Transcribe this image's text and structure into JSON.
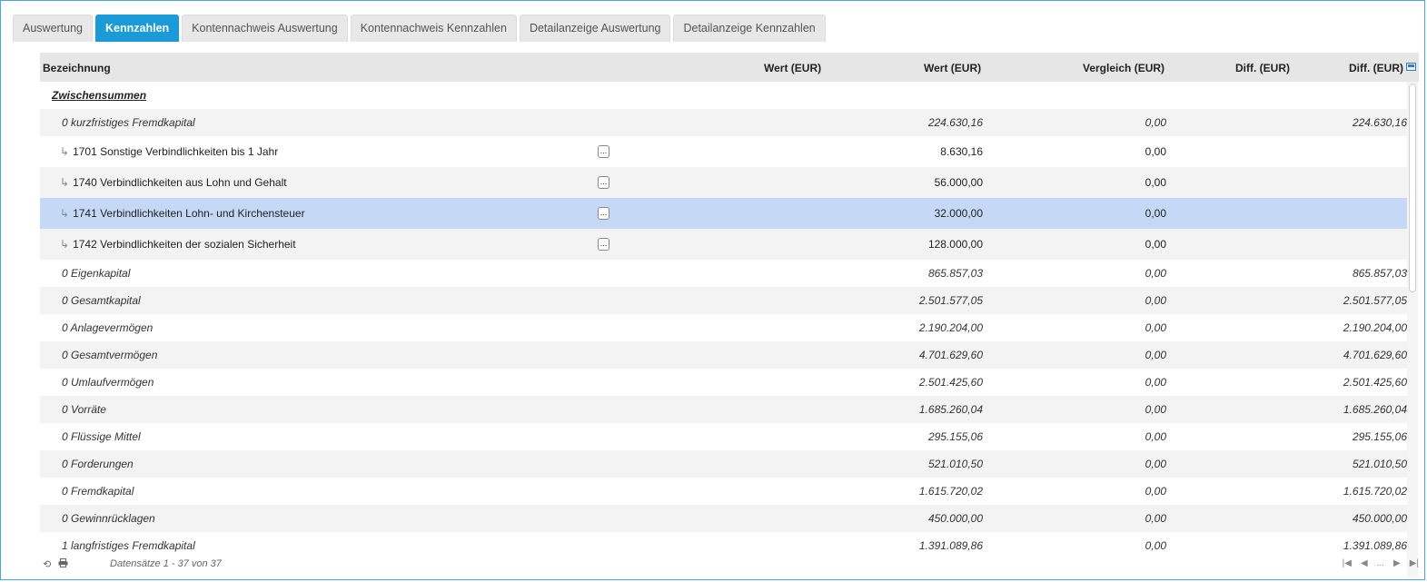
{
  "tabs": [
    {
      "label": "Auswertung",
      "active": false
    },
    {
      "label": "Kennzahlen",
      "active": true
    },
    {
      "label": "Kontennachweis Auswertung",
      "active": false
    },
    {
      "label": "Kontennachweis Kennzahlen",
      "active": false
    },
    {
      "label": "Detailanzeige Auswertung",
      "active": false
    },
    {
      "label": "Detailanzeige Kennzahlen",
      "active": false
    }
  ],
  "grid": {
    "headers": {
      "bezeichnung": "Bezeichnung",
      "wert1": "Wert (EUR)",
      "wert2": "Wert (EUR)",
      "vergleich": "Vergleich (EUR)",
      "diff1": "Diff. (EUR)",
      "diff2": "Diff. (EUR)"
    },
    "group_label": "Zwischensummen",
    "more_label": "...",
    "rows": [
      {
        "label": "0 kurzfristiges Fremdkapital",
        "wert": "224.630,16",
        "vergleich": "0,00",
        "diff": "224.630,16"
      },
      {
        "label": "1701 Sonstige Verbindlichkeiten bis 1 Jahr",
        "wert": "8.630,16",
        "vergleich": "0,00",
        "diff": ""
      },
      {
        "label": "1740 Verbindlichkeiten aus Lohn und Gehalt",
        "wert": "56.000,00",
        "vergleich": "0,00",
        "diff": ""
      },
      {
        "label": "1741 Verbindlichkeiten Lohn- und Kirchensteuer",
        "wert": "32.000,00",
        "vergleich": "0,00",
        "diff": ""
      },
      {
        "label": "1742 Verbindlichkeiten der sozialen Sicherheit",
        "wert": "128.000,00",
        "vergleich": "0,00",
        "diff": ""
      },
      {
        "label": "0 Eigenkapital",
        "wert": "865.857,03",
        "vergleich": "0,00",
        "diff": "865.857,03"
      },
      {
        "label": "0 Gesamtkapital",
        "wert": "2.501.577,05",
        "vergleich": "0,00",
        "diff": "2.501.577,05"
      },
      {
        "label": "0 Anlagevermögen",
        "wert": "2.190.204,00",
        "vergleich": "0,00",
        "diff": "2.190.204,00"
      },
      {
        "label": "0 Gesamtvermögen",
        "wert": "4.701.629,60",
        "vergleich": "0,00",
        "diff": "4.701.629,60"
      },
      {
        "label": "0 Umlaufvermögen",
        "wert": "2.501.425,60",
        "vergleich": "0,00",
        "diff": "2.501.425,60"
      },
      {
        "label": "0 Vorräte",
        "wert": "1.685.260,04",
        "vergleich": "0,00",
        "diff": "1.685.260,04"
      },
      {
        "label": "0 Flüssige Mittel",
        "wert": "295.155,06",
        "vergleich": "0,00",
        "diff": "295.155,06"
      },
      {
        "label": "0 Forderungen",
        "wert": "521.010,50",
        "vergleich": "0,00",
        "diff": "521.010,50"
      },
      {
        "label": "0 Fremdkapital",
        "wert": "1.615.720,02",
        "vergleich": "0,00",
        "diff": "1.615.720,02"
      },
      {
        "label": "0 Gewinnrücklagen",
        "wert": "450.000,00",
        "vergleich": "0,00",
        "diff": "450.000,00"
      },
      {
        "label": "1 langfristiges Fremdkapital",
        "wert": "1.391.089,86",
        "vergleich": "0,00",
        "diff": "1.391.089,86"
      }
    ]
  },
  "footer": {
    "status": "Datensätze 1 - 37 von 37",
    "pager_ellipsis": "..."
  },
  "colors": {
    "accent": "#1a9ad6",
    "selected_row": "#c5d9f7"
  }
}
